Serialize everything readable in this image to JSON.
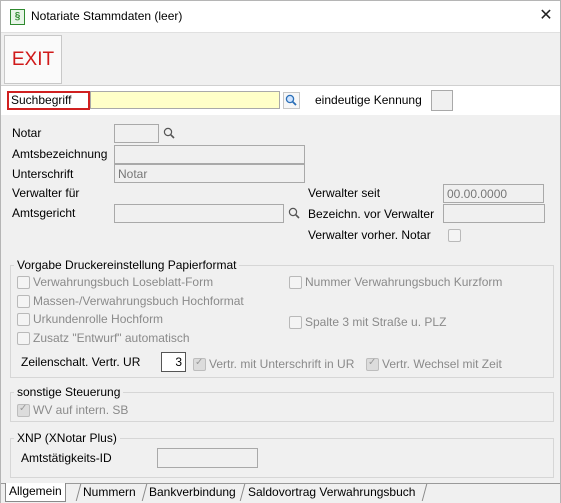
{
  "window": {
    "title": "Notariate Stammdaten (leer)",
    "app_icon_glyph": "§",
    "close_glyph": "✕"
  },
  "toolbar": {
    "exit_label": "EXIT"
  },
  "search": {
    "label": "Suchbegriff",
    "value": "",
    "unique_id_label": "eindeutige Kennung"
  },
  "fields": {
    "notar_label": "Notar",
    "amtsbezeichnung_label": "Amtsbezeichnung",
    "unterschrift_label": "Unterschrift",
    "unterschrift_value": "Notar",
    "verwalter_fuer_label": "Verwalter für",
    "amtsgericht_label": "Amtsgericht",
    "verwalter_seit_label": "Verwalter seit",
    "verwalter_seit_value": "00.00.0000",
    "bezeichn_label": "Bezeichn. vor Verwalter",
    "verwalter_vorher_label": "Verwalter vorher. Notar"
  },
  "drucker": {
    "title": "Vorgabe Druckereinstellung Papierformat",
    "loseblatt": "Verwahrungsbuch Loseblatt-Form",
    "kurzform": "Nummer Verwahrungsbuch Kurzform",
    "massen": "Massen-/Verwahrungsbuch Hochformat",
    "urkundenrolle": "Urkundenrolle Hochform",
    "spalte3": "Spalte 3 mit Straße u. PLZ",
    "entwurf": "Zusatz \"Entwurf\" automatisch",
    "zeilenschalt_label": "Zeilenschalt. Vertr. UR",
    "zeilenschalt_value": "3",
    "vertr_unterschrift": "Vertr. mit Unterschrift in UR",
    "vertr_wechsel": "Vertr. Wechsel mit Zeit"
  },
  "steuerung": {
    "title": "sonstige Steuerung",
    "wv": "WV auf intern. SB"
  },
  "xnp": {
    "title": "XNP (XNotar Plus)",
    "amts_id_label": "Amtstätigkeits-ID"
  },
  "tabs": [
    "Allgemein",
    "Nummern",
    "Bankverbindung",
    "Saldovortrag Verwahrungsbuch"
  ],
  "colors": {
    "exit_red": "#d01a1a",
    "search_yellow": "#ffffc8",
    "highlight_border": "#d02020"
  }
}
